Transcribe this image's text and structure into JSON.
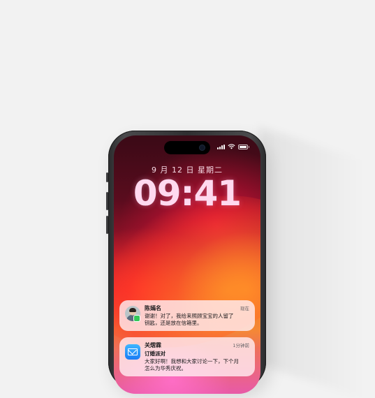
{
  "lockscreen": {
    "date": "9 月 12 日 星期二",
    "time": "09:41"
  },
  "notifications": [
    {
      "sender": "陈嫣名",
      "time": "现在",
      "body_line1": "谢谢！对了，我给来照顾宝宝的人留了",
      "body_line2": "钥匙，还是放在信箱里。",
      "app": "messages"
    },
    {
      "sender": "关熠霖",
      "time": "1分钟前",
      "subject": "订婚派对",
      "body_line1": "大家好啊！我想和大家讨论一下，下个月",
      "body_line2": "怎么为华秀庆祝。",
      "app": "mail"
    }
  ],
  "colors": {
    "background": "#f2f2f2",
    "phone_frame": "#2f2f31",
    "time_text": "#ffd9ef"
  },
  "icons": [
    "signal-icon",
    "wifi-icon",
    "battery-icon",
    "contact-avatar",
    "messages-badge-icon",
    "mail-app-icon"
  ]
}
